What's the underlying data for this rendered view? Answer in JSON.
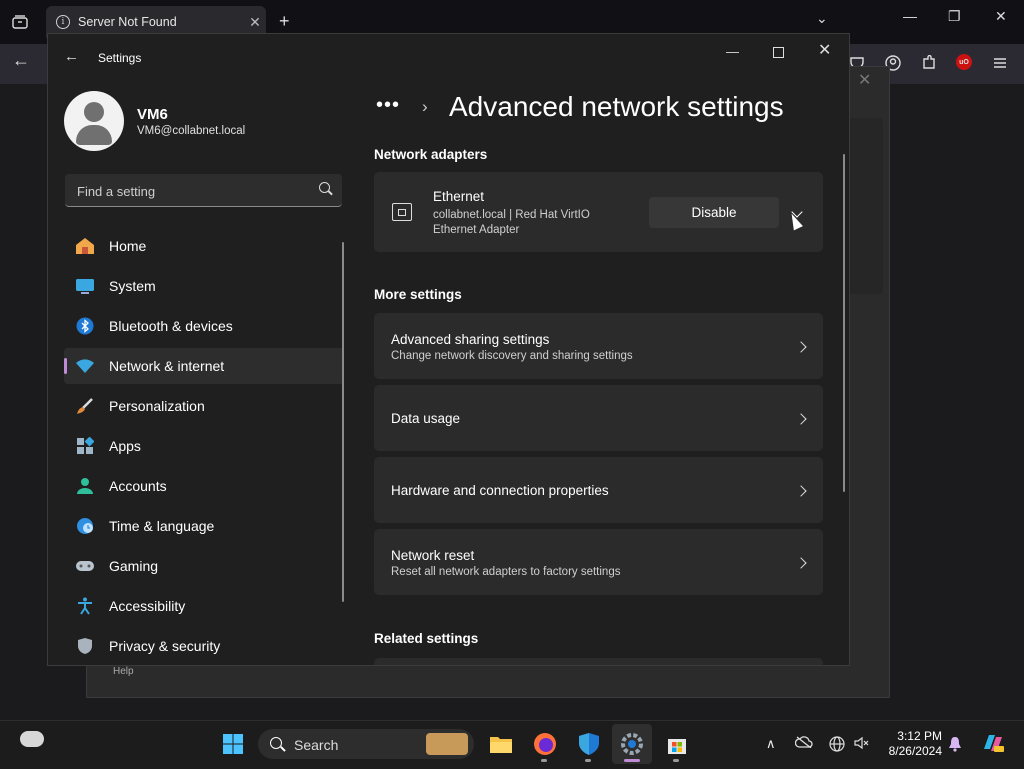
{
  "browser": {
    "tab_title": "Server Not Found",
    "dialog_help": "Help",
    "ublock_label": "uO"
  },
  "settings": {
    "window_title": "Settings",
    "user": {
      "name": "VM6",
      "email": "VM6@collabnet.local"
    },
    "search_placeholder": "Find a setting",
    "nav": [
      {
        "label": "Home",
        "icon": "home-icon"
      },
      {
        "label": "System",
        "icon": "system-icon"
      },
      {
        "label": "Bluetooth & devices",
        "icon": "bluetooth-icon"
      },
      {
        "label": "Network & internet",
        "icon": "wifi-icon",
        "active": true
      },
      {
        "label": "Personalization",
        "icon": "brush-icon"
      },
      {
        "label": "Apps",
        "icon": "apps-icon"
      },
      {
        "label": "Accounts",
        "icon": "accounts-icon"
      },
      {
        "label": "Time & language",
        "icon": "globe-clock-icon"
      },
      {
        "label": "Gaming",
        "icon": "gamepad-icon"
      },
      {
        "label": "Accessibility",
        "icon": "accessibility-icon"
      },
      {
        "label": "Privacy & security",
        "icon": "shield-icon"
      }
    ],
    "breadcrumb_ellipsis": "•••",
    "page_title": "Advanced network settings",
    "network_adapters": {
      "heading": "Network adapters",
      "adapter": {
        "name": "Ethernet",
        "description": "collabnet.local | Red Hat VirtIO Ethernet Adapter",
        "button": "Disable"
      }
    },
    "more_settings": {
      "heading": "More settings",
      "items": [
        {
          "title": "Advanced sharing settings",
          "description": "Change network discovery and sharing settings"
        },
        {
          "title": "Data usage",
          "description": ""
        },
        {
          "title": "Hardware and connection properties",
          "description": ""
        },
        {
          "title": "Network reset",
          "description": "Reset all network adapters to factory settings"
        }
      ]
    },
    "related_settings": {
      "heading": "Related settings"
    }
  },
  "taskbar": {
    "search_label": "Search",
    "time": "3:12 PM",
    "date": "8/26/2024"
  },
  "colors": {
    "accent": "#c08bd6",
    "window_bg": "#1f1f1f",
    "card_bg": "#2b2b2b"
  }
}
